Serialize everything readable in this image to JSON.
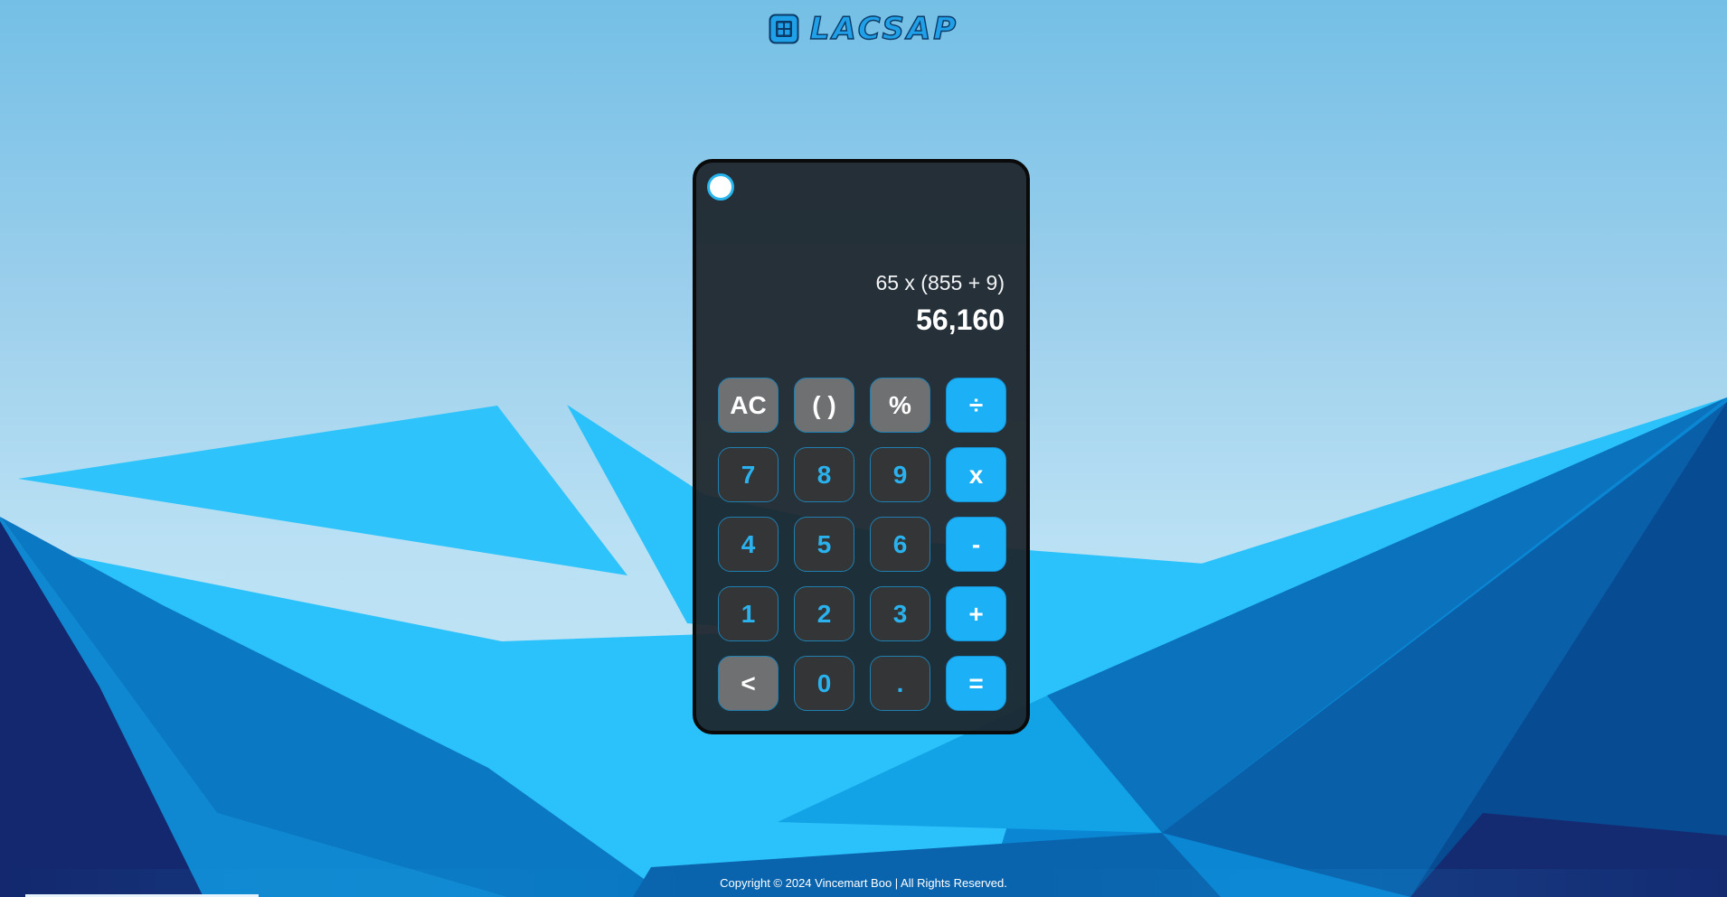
{
  "app": {
    "title": "LACSAP",
    "logo_icon": "calculator-icon",
    "accent_color": "#1cb1f7"
  },
  "calculator": {
    "theme_toggle_icon": "circle-toggle",
    "expression": "65 x (855 + 9)",
    "result": "56,160",
    "keys": [
      {
        "label": "AC",
        "kind": "func",
        "name": "clear-button"
      },
      {
        "label": "( )",
        "kind": "func",
        "name": "parentheses-button"
      },
      {
        "label": "%",
        "kind": "func",
        "name": "percent-button"
      },
      {
        "label": "÷",
        "kind": "op",
        "name": "divide-button"
      },
      {
        "label": "7",
        "kind": "num",
        "name": "digit-7-button"
      },
      {
        "label": "8",
        "kind": "num",
        "name": "digit-8-button"
      },
      {
        "label": "9",
        "kind": "num",
        "name": "digit-9-button"
      },
      {
        "label": "x",
        "kind": "op",
        "name": "multiply-button"
      },
      {
        "label": "4",
        "kind": "num",
        "name": "digit-4-button"
      },
      {
        "label": "5",
        "kind": "num",
        "name": "digit-5-button"
      },
      {
        "label": "6",
        "kind": "num",
        "name": "digit-6-button"
      },
      {
        "label": "-",
        "kind": "op",
        "name": "subtract-button"
      },
      {
        "label": "1",
        "kind": "num",
        "name": "digit-1-button"
      },
      {
        "label": "2",
        "kind": "num",
        "name": "digit-2-button"
      },
      {
        "label": "3",
        "kind": "num",
        "name": "digit-3-button"
      },
      {
        "label": "+",
        "kind": "op",
        "name": "add-button"
      },
      {
        "label": "<",
        "kind": "func",
        "name": "backspace-button"
      },
      {
        "label": "0",
        "kind": "num",
        "name": "digit-0-button"
      },
      {
        "label": ".",
        "kind": "num",
        "name": "decimal-point-button"
      },
      {
        "label": "=",
        "kind": "op",
        "name": "equals-button"
      }
    ]
  },
  "footer": {
    "copyright": "Copyright © 2024 Vincemart Boo | All Rights Reserved."
  }
}
